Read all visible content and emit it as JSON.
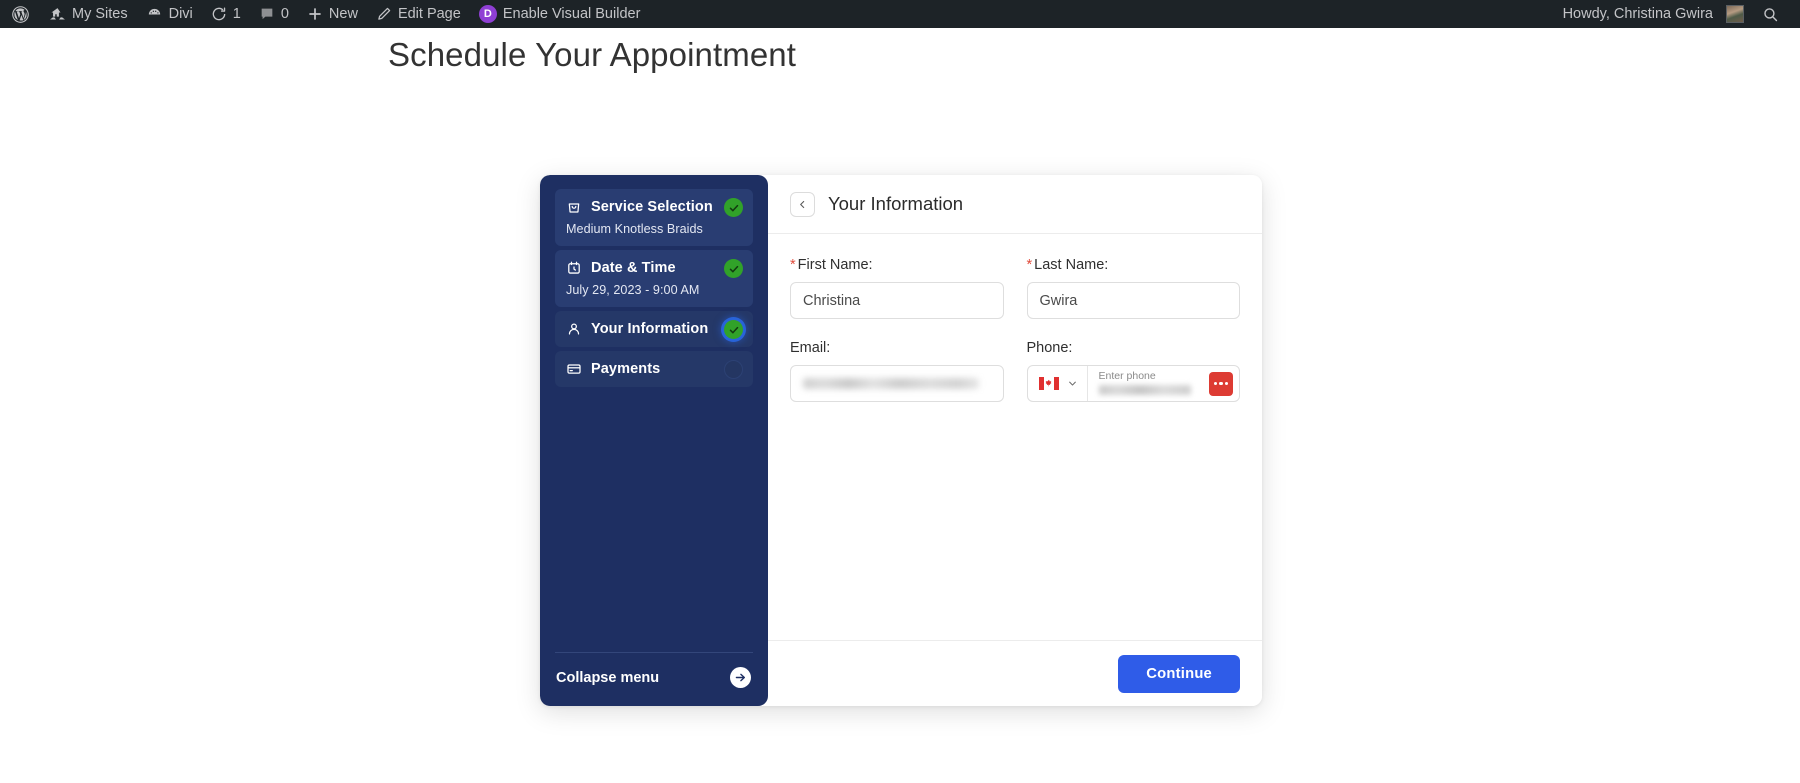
{
  "adminbar": {
    "left_items": [
      {
        "icon": "wordpress-logo-icon",
        "label": ""
      },
      {
        "icon": "sites-icon",
        "label": "My Sites"
      },
      {
        "icon": "divi-icon",
        "label": "Divi"
      },
      {
        "icon": "updates-icon",
        "label": "1"
      },
      {
        "icon": "comments-icon",
        "label": "0"
      },
      {
        "icon": "plus-icon",
        "label": "New"
      },
      {
        "icon": "pencil-icon",
        "label": "Edit Page"
      },
      {
        "icon": "divi-d-badge-icon",
        "label": "Enable Visual Builder"
      }
    ],
    "howdy": "Howdy, Christina Gwira",
    "search_icon": "search-icon",
    "avatar": "user-avatar"
  },
  "page": {
    "title": "Schedule Your Appointment"
  },
  "booking": {
    "sidebar": {
      "steps": [
        {
          "icon": "service-bag-icon",
          "title": "Service Selection",
          "subtitle": "Medium Knotless Braids",
          "status": "done"
        },
        {
          "icon": "calendar-clock-icon",
          "title": "Date & Time",
          "subtitle": "July 29, 2023 - 9:00 AM",
          "status": "done"
        },
        {
          "icon": "person-icon",
          "title": "Your Information",
          "subtitle": "",
          "status": "active"
        },
        {
          "icon": "credit-card-icon",
          "title": "Payments",
          "subtitle": "",
          "status": "pending"
        }
      ],
      "collapse_label": "Collapse menu",
      "collapse_icon": "arrow-right-circle-icon"
    },
    "main": {
      "back_icon": "chevron-left-icon",
      "header_title": "Your Information",
      "fields": {
        "first_name": {
          "label": "First Name:",
          "required_mark": "*",
          "value": "Christina",
          "placeholder": ""
        },
        "last_name": {
          "label": "Last Name:",
          "required_mark": "*",
          "value": "Gwira",
          "placeholder": ""
        },
        "email": {
          "label": "Email:",
          "value": "",
          "placeholder": ""
        },
        "phone": {
          "label": "Phone:",
          "country_flag": "canada-flag-icon",
          "country_chevron": "chevron-down-icon",
          "float_label": "Enter phone",
          "value": "",
          "dots_icon": "more-options-icon"
        }
      },
      "continue_label": "Continue"
    }
  },
  "colors": {
    "adminbar_bg": "#1d2327",
    "sidebar_bg": "#1e2f62",
    "step_bg": "#293d72",
    "accent_blue": "#2f5ce8",
    "success_green": "#31a229",
    "required_red": "#e04a3a",
    "divi_purple": "#8f3fd4",
    "phone_red": "#dd3b33"
  }
}
